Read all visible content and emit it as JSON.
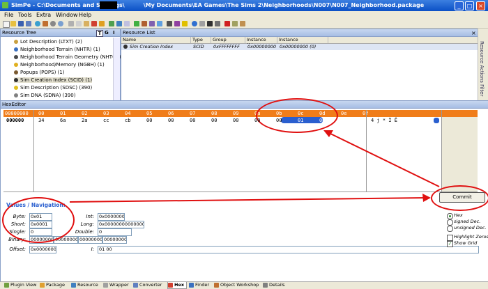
{
  "window": {
    "title_prefix": "SimPe - C:\\Documents and Settings\\",
    "title_suffix": "\\My Documents\\EA Games\\The Sims 2\\Neighborhoods\\N007\\N007_Neighborhood.package",
    "min": "_",
    "max": "□",
    "close": "×"
  },
  "menu": [
    "File",
    "Tools",
    "Extra",
    "Window",
    "Help"
  ],
  "resource_tree": {
    "title": "Resource Tree",
    "buttons": [
      "T",
      "G",
      "I"
    ],
    "items": [
      {
        "label": "Lot Description (LTXT) (2)",
        "color": "#c8a040"
      },
      {
        "label": "Neighborhood Terrain (NHTR) (1)",
        "color": "#3a70c0"
      },
      {
        "label": "Neighborhood Terrain Geometry (NHTG) (1)",
        "color": "#4a4a4a"
      },
      {
        "label": "Neighborhood/Memory (NGBH) (1)",
        "color": "#e0b020"
      },
      {
        "label": "Popups (POPS) (1)",
        "color": "#7a5a30"
      },
      {
        "label": "Sim Creation Index (SCID) (1)",
        "color": "#303030"
      },
      {
        "label": "Sim Description (SDSC) (390)",
        "color": "#e0c020"
      },
      {
        "label": "Sim DNA (SDNA) (390)",
        "color": "#808080"
      }
    ]
  },
  "resource_list": {
    "title": "Resource List",
    "headers": [
      "Name",
      "Type",
      "Group",
      "Instance (hi...",
      "Instance"
    ],
    "row": {
      "name": "Sim Creation Index",
      "type": "SCID",
      "group": "0xFFFFFFFF",
      "instance_hi": "0x00000000",
      "instance": "0x00000000 (0)"
    }
  },
  "side_tabs": [
    "Resource Actions",
    "Filter"
  ],
  "hex": {
    "title": "HexEditor",
    "corner": "00000000",
    "columns": [
      "00",
      "01",
      "02",
      "03",
      "04",
      "05",
      "06",
      "07",
      "08",
      "09",
      "0a",
      "0b",
      "0c",
      "0d",
      "0e",
      "0f"
    ],
    "row_addr": "000000",
    "values": [
      "34",
      "6a",
      "2a",
      "cc",
      "cb",
      "00",
      "00",
      "00",
      "00",
      "00",
      "00",
      "00",
      "01",
      "00",
      "",
      ""
    ],
    "ascii": "4 j * Ì Ë",
    "commit": "Commit"
  },
  "values_nav": {
    "title": "Values / Navigation:",
    "byte": {
      "label": "Byte:",
      "value": "0x01"
    },
    "short": {
      "label": "Short:",
      "value": "0x0001"
    },
    "single": {
      "label": "Single:",
      "value": "0"
    },
    "binary": {
      "label": "Binary:",
      "values": [
        "00000000",
        "00000000",
        "00000000",
        "00000000"
      ]
    },
    "int": {
      "label": "Int:",
      "value": "0x00000000"
    },
    "long": {
      "label": "Long:",
      "value": "0x0000000000000000"
    },
    "double": {
      "label": "Double:",
      "value": "0"
    },
    "offset": {
      "label": "Offset:",
      "value": "0x00000000"
    },
    "string": {
      "label": "I:",
      "value": "01 00"
    },
    "radios": [
      "Hex",
      "signed Dec.",
      "unsigned Dec."
    ],
    "checks": [
      "Highlight Zeros",
      "Show Grid"
    ]
  },
  "tabs": [
    "Plugin View",
    "Package",
    "Resource",
    "Wrapper",
    "Converter",
    "Hex",
    "Finder",
    "Object Workshop",
    "Details"
  ],
  "colors": {
    "accent": "#f07d1a",
    "annotation": "#e01010",
    "selection": "#2a5fcf"
  }
}
